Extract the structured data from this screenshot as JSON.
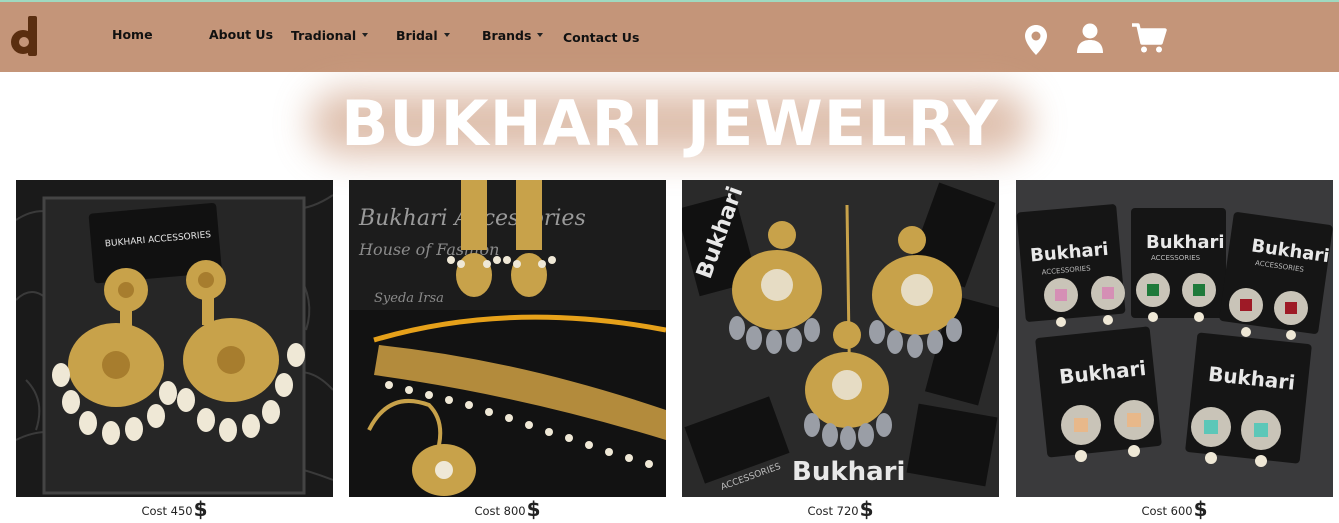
{
  "brand": {
    "logo_letter": "d"
  },
  "nav": {
    "home": "Home",
    "about": "About Us",
    "traditional": "Tradional",
    "bridal": "Bridal",
    "brands": "Brands",
    "contact": "Contact Us"
  },
  "header_icons": [
    "location-pin-icon",
    "user-icon",
    "shopping-cart-icon"
  ],
  "hero": {
    "title": "BUKHARI JEWELRY"
  },
  "products": [
    {
      "cost_label": "Cost 450",
      "currency": "$",
      "box_text": "BUKHARI ACCESSORIES"
    },
    {
      "cost_label": "Cost 800",
      "currency": "$",
      "box_text_1": "Bukhari Accessories",
      "box_text_2": "House of Fashion",
      "box_text_3": "Syeda Irsa"
    },
    {
      "cost_label": "Cost 720",
      "currency": "$",
      "box_text": "Bukhari",
      "box_sub": "ACCESSORIES"
    },
    {
      "cost_label": "Cost 600",
      "currency": "$",
      "box_text": "Bukhari",
      "box_sub": "ACCESSORIES"
    }
  ],
  "colors": {
    "navbar": "#c49579",
    "logo": "#5a2e10",
    "accent_line": "#9fd9c0",
    "gold": "#c8a24a",
    "pearl": "#efe8d6"
  }
}
